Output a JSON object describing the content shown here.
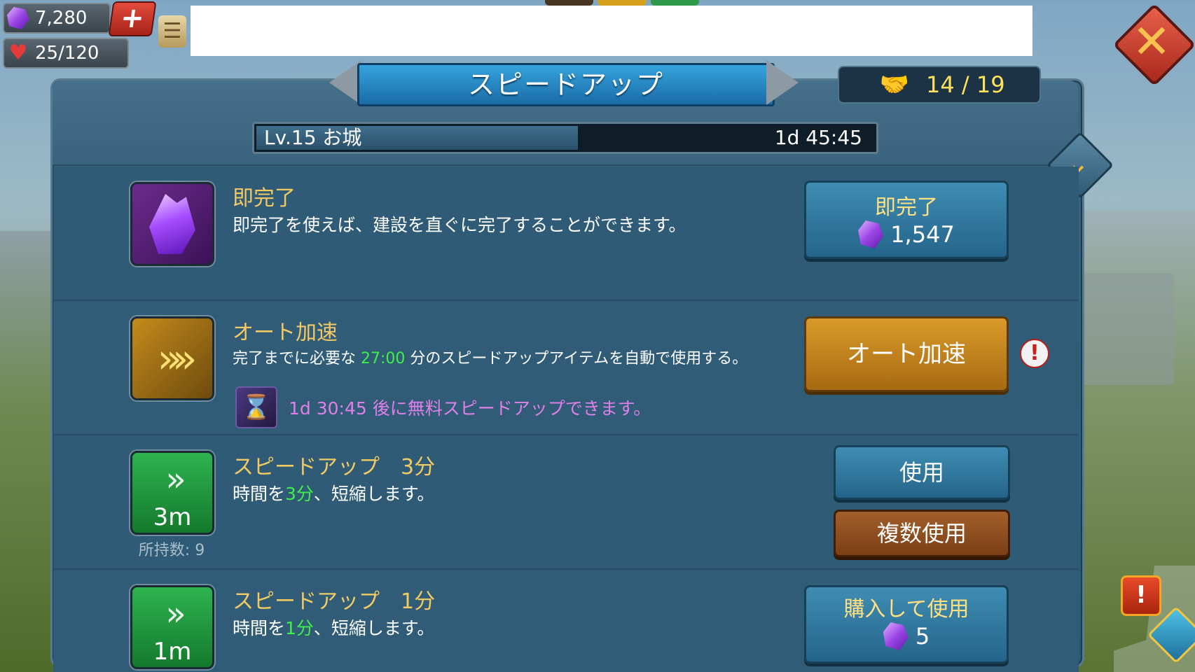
{
  "resources": {
    "gems": "7,280",
    "hearts": "25/120"
  },
  "top_tabs_colors": [
    "#4a3520",
    "#d6a21d",
    "#2f9a4a"
  ],
  "header": {
    "title": "スピードアップ",
    "alliance_help": "14 / 19"
  },
  "progress": {
    "label": "Lv.15 お城",
    "time_remaining": "1d 45:45",
    "fill_fraction": 0.52
  },
  "items": [
    {
      "icon": "purple-crystal-icon",
      "title": "即完了",
      "description": "即完了を使えば、建設を直ぐに完了することができます。",
      "button_title": "即完了",
      "button_cost": "1,547"
    },
    {
      "icon": "auto-speedup-icon",
      "title": "オート加速",
      "desc_prefix": "完了までに必要な",
      "desc_highlight": "27:00",
      "desc_suffix": "分のスピードアップアイテムを自動で使用する。",
      "free_hint": "1d 30:45 後に無料スピードアップできます。",
      "button_label": "オート加速"
    },
    {
      "icon": "speedup-3m-icon",
      "icon_text": "3m",
      "title": "スピードアップ　3分",
      "desc_prefix": "時間を",
      "desc_highlight": "3分",
      "desc_suffix": "、短縮します。",
      "owned": "所持数: 9",
      "use_label": "使用",
      "multi_use_label": "複数使用"
    },
    {
      "icon": "speedup-1m-icon",
      "icon_text": "1m",
      "title": "スピードアップ　1分",
      "desc_prefix": "時間を",
      "desc_highlight": "1分",
      "desc_suffix": "、短縮します。",
      "button_title": "購入して使用",
      "button_cost": "5"
    }
  ],
  "colors": {
    "title_gold": "#f3c963",
    "highlight_green": "#3ef04a",
    "free_hint_pink": "#e07fe8",
    "alliance_yellow": "#ffe05a"
  }
}
